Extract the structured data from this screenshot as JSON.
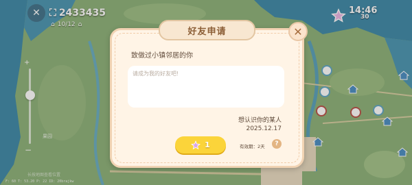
{
  "hud": {
    "coins": "2433435",
    "houses": "10/12",
    "time": "14:46",
    "star_count": "30"
  },
  "map_labels": {
    "label_west": "果园",
    "hint": "长按地图查看位置"
  },
  "debug_text": "F: 60   T: 53.20   P: 22   ID: 20brajkw",
  "dialog": {
    "title": "好友申请",
    "greeting": "致做过小镇邻居的你",
    "message_placeholder": "请成为我的好友吧!",
    "sender": "想认识你的某人",
    "date": "2025.12.17",
    "accept_count": "1",
    "validity": "有效期：2天",
    "help": "?",
    "close": "✕"
  },
  "colors": {
    "dialog_bg": "#fff4e6",
    "dialog_border": "#f1d3b3",
    "accept_button": "#fbd43a",
    "water": "#3e8fb0",
    "land": "#8bb07a"
  }
}
